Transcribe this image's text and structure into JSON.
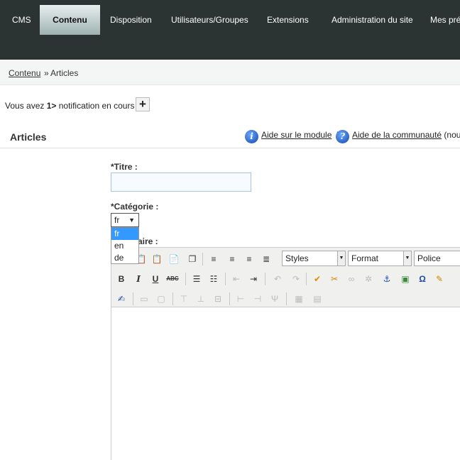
{
  "nav": {
    "items": [
      "CMS",
      "Contenu",
      "Disposition",
      "Utilisateurs/Groupes",
      "Extensions",
      "Administration du site",
      "Mes pré"
    ],
    "active": "Contenu"
  },
  "breadcrumb": {
    "link": "Contenu",
    "separator": "»",
    "current": "Articles"
  },
  "notification": {
    "prefix": "Vous avez",
    "count": "1>",
    "suffix": "notification en cours",
    "button": "+"
  },
  "section": {
    "title": "Articles",
    "help_module": "Aide sur le module",
    "help_separator": "|",
    "help_community": "Aide de la communauté",
    "help_trailing": "(nouv"
  },
  "form": {
    "title_label": "*Titre :",
    "title_value": "",
    "category_label": "*Catégorie :",
    "category_selected": "fr",
    "category_options": [
      "fr",
      "en",
      "de"
    ],
    "comment_label_visible": "aire :"
  },
  "editor": {
    "combos": {
      "styles": "Styles",
      "format": "Format",
      "font": "Police"
    }
  },
  "colors": {
    "nav_bg": "#2b3333",
    "active_tab": "#c5d3d3",
    "select_highlight": "#3399ff"
  }
}
